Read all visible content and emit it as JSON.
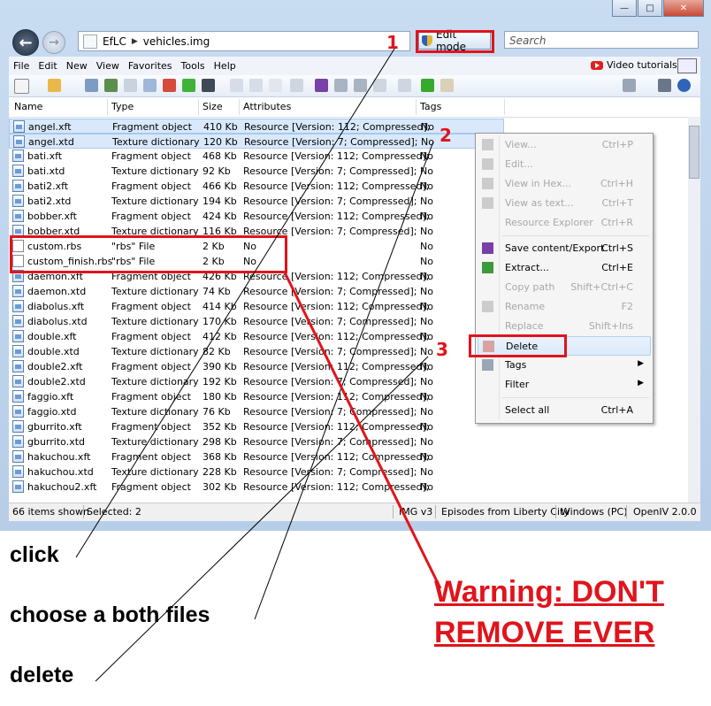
{
  "address": {
    "root": "EfLC",
    "file": "vehicles.img",
    "edit_mode_label": "Edit mode",
    "search_placeholder": "Search"
  },
  "menubar": {
    "items": [
      "File",
      "Edit",
      "New",
      "View",
      "Favorites",
      "Tools",
      "Help"
    ],
    "video_tutorials": "Video tutorials"
  },
  "columns": [
    "Name",
    "Type",
    "Size",
    "Attributes",
    "Tags"
  ],
  "rows": [
    {
      "name": "angel.xft",
      "type": "Fragment object",
      "size": "410 Kb",
      "attr": "Resource [Version: 112; Compressed];",
      "tags": "No",
      "selected": true
    },
    {
      "name": "angel.xtd",
      "type": "Texture dictionary",
      "size": "120 Kb",
      "attr": "Resource [Version: 7; Compressed];",
      "tags": "No",
      "selected": true
    },
    {
      "name": "bati.xft",
      "type": "Fragment object",
      "size": "468 Kb",
      "attr": "Resource [Version: 112; Compressed];",
      "tags": "No"
    },
    {
      "name": "bati.xtd",
      "type": "Texture dictionary",
      "size": "92 Kb",
      "attr": "Resource [Version: 7; Compressed];",
      "tags": "No"
    },
    {
      "name": "bati2.xft",
      "type": "Fragment object",
      "size": "466 Kb",
      "attr": "Resource [Version: 112; Compressed];",
      "tags": "No"
    },
    {
      "name": "bati2.xtd",
      "type": "Texture dictionary",
      "size": "194 Kb",
      "attr": "Resource [Version: 7; Compressed];",
      "tags": "No"
    },
    {
      "name": "bobber.xft",
      "type": "Fragment object",
      "size": "424 Kb",
      "attr": "Resource [Version: 112; Compressed];",
      "tags": "No"
    },
    {
      "name": "bobber.xtd",
      "type": "Texture dictionary",
      "size": "116 Kb",
      "attr": "Resource [Version: 7; Compressed];",
      "tags": "No"
    },
    {
      "name": "custom.rbs",
      "type": "\"rbs\" File",
      "size": "2 Kb",
      "attr": "No",
      "tags": "No",
      "plain": true
    },
    {
      "name": "custom_finish.rbs",
      "type": "\"rbs\" File",
      "size": "2 Kb",
      "attr": "No",
      "tags": "No",
      "plain": true
    },
    {
      "name": "daemon.xft",
      "type": "Fragment object",
      "size": "426 Kb",
      "attr": "Resource [Version: 112; Compressed];",
      "tags": "No"
    },
    {
      "name": "daemon.xtd",
      "type": "Texture dictionary",
      "size": "74 Kb",
      "attr": "Resource [Version: 7; Compressed];",
      "tags": "No"
    },
    {
      "name": "diabolus.xft",
      "type": "Fragment object",
      "size": "414 Kb",
      "attr": "Resource [Version: 112; Compressed];",
      "tags": "No"
    },
    {
      "name": "diabolus.xtd",
      "type": "Texture dictionary",
      "size": "170 Kb",
      "attr": "Resource [Version: 7; Compressed];",
      "tags": "No"
    },
    {
      "name": "double.xft",
      "type": "Fragment object",
      "size": "412 Kb",
      "attr": "Resource [Version: 112; Compressed];",
      "tags": "No"
    },
    {
      "name": "double.xtd",
      "type": "Texture dictionary",
      "size": "82 Kb",
      "attr": "Resource [Version: 7; Compressed];",
      "tags": "No"
    },
    {
      "name": "double2.xft",
      "type": "Fragment object",
      "size": "390 Kb",
      "attr": "Resource [Version: 112; Compressed];",
      "tags": "No"
    },
    {
      "name": "double2.xtd",
      "type": "Texture dictionary",
      "size": "192 Kb",
      "attr": "Resource [Version: 7; Compressed];",
      "tags": "No"
    },
    {
      "name": "faggio.xft",
      "type": "Fragment object",
      "size": "180 Kb",
      "attr": "Resource [Version: 112; Compressed];",
      "tags": "No"
    },
    {
      "name": "faggio.xtd",
      "type": "Texture dictionary",
      "size": "76 Kb",
      "attr": "Resource [Version: 7; Compressed];",
      "tags": "No"
    },
    {
      "name": "gburrito.xft",
      "type": "Fragment object",
      "size": "352 Kb",
      "attr": "Resource [Version: 112; Compressed];",
      "tags": "No"
    },
    {
      "name": "gburrito.xtd",
      "type": "Texture dictionary",
      "size": "298 Kb",
      "attr": "Resource [Version: 7; Compressed];",
      "tags": "No"
    },
    {
      "name": "hakuchou.xft",
      "type": "Fragment object",
      "size": "368 Kb",
      "attr": "Resource [Version: 112; Compressed];",
      "tags": "No"
    },
    {
      "name": "hakuchou.xtd",
      "type": "Texture dictionary",
      "size": "228 Kb",
      "attr": "Resource [Version: 7; Compressed];",
      "tags": "No"
    },
    {
      "name": "hakuchou2.xft",
      "type": "Fragment object",
      "size": "302 Kb",
      "attr": "Resource [Version: 112; Compressed];",
      "tags": "No"
    }
  ],
  "context_menu": [
    {
      "label": "View...",
      "shortcut": "Ctrl+P",
      "disabled": true
    },
    {
      "label": "Edit...",
      "shortcut": "",
      "disabled": true
    },
    {
      "label": "View in Hex...",
      "shortcut": "Ctrl+H",
      "disabled": true
    },
    {
      "label": "View as text...",
      "shortcut": "Ctrl+T",
      "disabled": true
    },
    {
      "label": "Resource Explorer",
      "shortcut": "Ctrl+R",
      "disabled": true
    },
    {
      "label": "Save content/Export",
      "shortcut": "Ctrl+S",
      "disabled": false
    },
    {
      "label": "Extract...",
      "shortcut": "Ctrl+E",
      "disabled": false
    },
    {
      "label": "Copy path",
      "shortcut": "Shift+Ctrl+C",
      "disabled": true
    },
    {
      "label": "Rename",
      "shortcut": "F2",
      "disabled": true
    },
    {
      "label": "Replace",
      "shortcut": "Shift+Ins",
      "disabled": true
    },
    {
      "label": "Delete",
      "shortcut": "",
      "disabled": false,
      "highlighted": true
    },
    {
      "label": "Tags",
      "shortcut": "",
      "disabled": false,
      "submenu": true
    },
    {
      "label": "Filter",
      "shortcut": "",
      "disabled": false,
      "submenu": true
    },
    {
      "label": "Select all",
      "shortcut": "Ctrl+A",
      "disabled": false
    }
  ],
  "status": {
    "items_shown": "66 items shown",
    "selected": "Selected: 2",
    "img_version": "IMG v3",
    "game": "Episodes from Liberty City",
    "platform": "Windows (PC)",
    "app_version": "OpenIV 2.0.0"
  },
  "annotations": {
    "step1": "1",
    "step2": "2",
    "step3": "3",
    "click": "click",
    "choose": "choose a both files",
    "delete": "delete",
    "warning_line1": "Warning: DON'T",
    "warning_line2": "REMOVE EVER"
  },
  "colors": {
    "annotation_red": "#e0141c",
    "selection": "#d9e9fb"
  }
}
